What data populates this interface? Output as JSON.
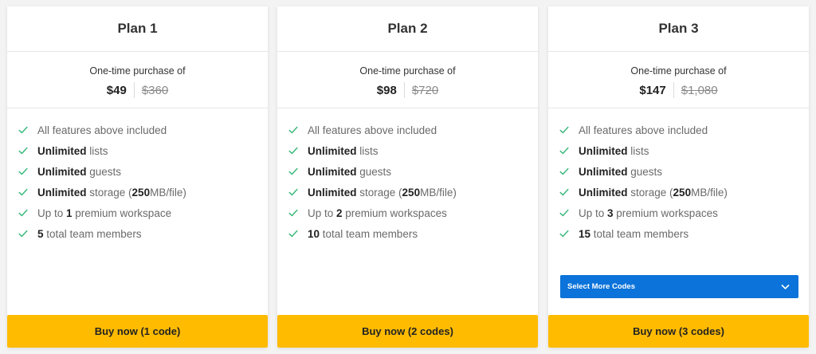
{
  "colors": {
    "accent_yellow": "#ffbb00",
    "select_blue": "#0b73d9",
    "check_green": "#35b779",
    "background": "#f3f3f3"
  },
  "plans": [
    {
      "title": "Plan 1",
      "caption": "One-time purchase of",
      "price_now": "$49",
      "price_old": "$360",
      "features": [
        {
          "bold": "",
          "text": "All features above included"
        },
        {
          "bold": "Unlimited",
          "text": " lists"
        },
        {
          "bold": "Unlimited",
          "text": " guests"
        },
        {
          "bold": "Unlimited",
          "text": " storage (",
          "bold2": "250",
          "text2": "MB/file)"
        },
        {
          "pre": "Up to ",
          "bold": "1",
          "text": " premium workspace"
        },
        {
          "bold": "5",
          "text": " total team members"
        }
      ],
      "buy_label": "Buy now (1 code)"
    },
    {
      "title": "Plan 2",
      "caption": "One-time purchase of",
      "price_now": "$98",
      "price_old": "$720",
      "features": [
        {
          "bold": "",
          "text": "All features above included"
        },
        {
          "bold": "Unlimited",
          "text": " lists"
        },
        {
          "bold": "Unlimited",
          "text": " guests"
        },
        {
          "bold": "Unlimited",
          "text": " storage (",
          "bold2": "250",
          "text2": "MB/file)"
        },
        {
          "pre": "Up to ",
          "bold": "2",
          "text": " premium workspaces"
        },
        {
          "bold": "10",
          "text": " total team members"
        }
      ],
      "buy_label": "Buy now (2 codes)"
    },
    {
      "title": "Plan 3",
      "caption": "One-time purchase of",
      "price_now": "$147",
      "price_old": "$1,080",
      "features": [
        {
          "bold": "",
          "text": "All features above included"
        },
        {
          "bold": "Unlimited",
          "text": " lists"
        },
        {
          "bold": "Unlimited",
          "text": " guests"
        },
        {
          "bold": "Unlimited",
          "text": " storage (",
          "bold2": "250",
          "text2": "MB/file)"
        },
        {
          "pre": "Up to ",
          "bold": "3",
          "text": " premium workspaces"
        },
        {
          "bold": "15",
          "text": " total team members"
        }
      ],
      "select_label": "Select More Codes",
      "buy_label": "Buy now (3 codes)"
    }
  ],
  "icons": {
    "feature": "check-icon",
    "select": "chevron-down-icon"
  }
}
